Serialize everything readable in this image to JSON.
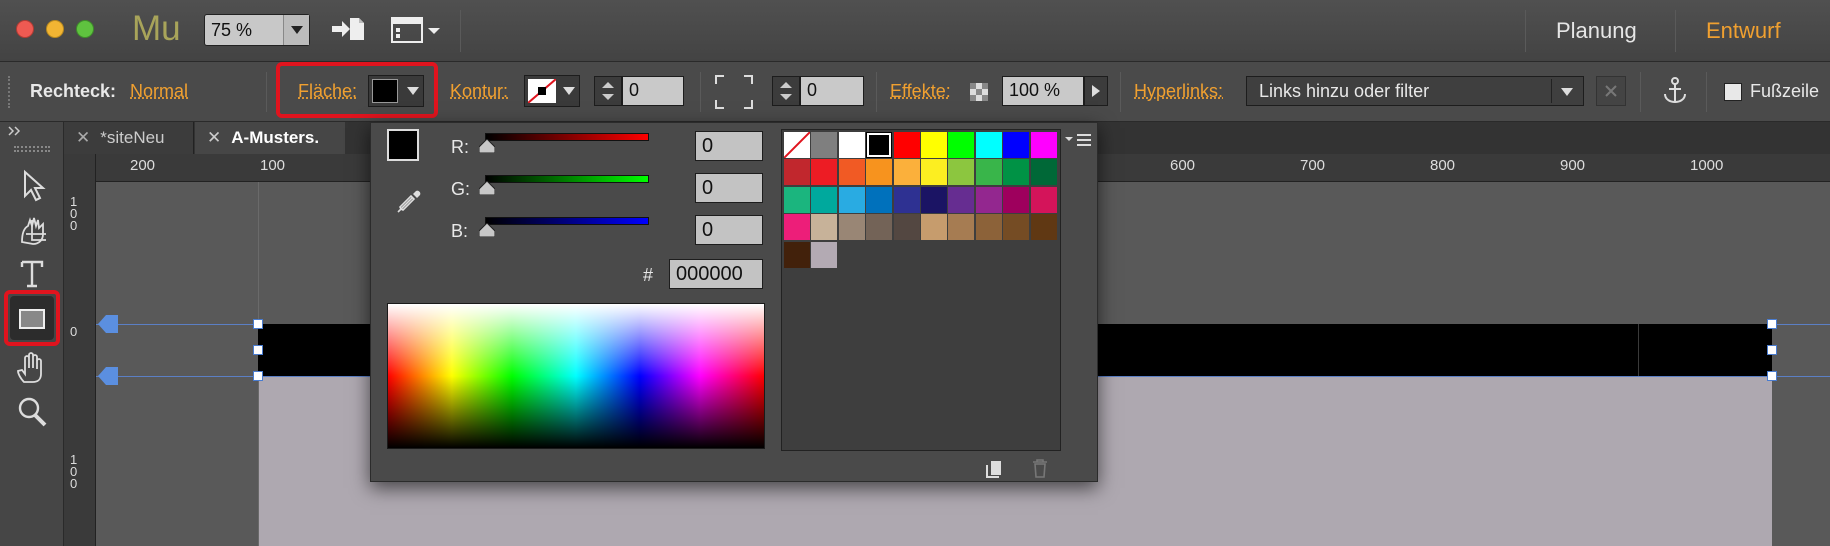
{
  "titlebar": {
    "app_logo": "Mu",
    "zoom": "75 %",
    "modes": {
      "planning": "Planung",
      "design": "Entwurf"
    },
    "traffic_lights": {
      "close": "#ee5a52",
      "minimize": "#f2b533",
      "zoom": "#5fc23f"
    }
  },
  "controlbar": {
    "object_label": "Rechteck:",
    "state": "Normal",
    "fill_label": "Fläche:",
    "stroke_label": "Kontur:",
    "stroke_width": "0",
    "corner_radius": "0",
    "effects_label": "Effekte:",
    "opacity": "100 %",
    "hyperlinks_label": "Hyperlinks:",
    "hyperlinks_placeholder": "Links hinzu oder filter",
    "footer_label": "Fußzeile"
  },
  "tabs": [
    {
      "label": "*siteNeu"
    },
    {
      "label": "A-Musters."
    }
  ],
  "ruler": {
    "top_ticks": [
      "200",
      "100",
      "600",
      "700",
      "800",
      "900",
      "1000"
    ],
    "left_ticks": [
      "100",
      "0",
      "0",
      "100"
    ]
  },
  "color_picker": {
    "r_label": "R:",
    "g_label": "G:",
    "b_label": "B:",
    "r": "0",
    "g": "0",
    "b": "0",
    "hash_label": "#",
    "hex": "000000",
    "current_color": "#000000",
    "swatches": [
      [
        "none",
        "#7f7f7f",
        "#ffffff",
        "#000000",
        "#ff0000",
        "#ffff00",
        "#00ff00",
        "#00ffff",
        "#0000ff",
        "#ff00ff"
      ],
      [
        "#c1272d",
        "#ed1c24",
        "#f15a24",
        "#f7931e",
        "#fbb03b",
        "#fcee21",
        "#8cc63f",
        "#39b54a",
        "#009245",
        "#006837"
      ],
      [
        "#1bb57e",
        "#00a99d",
        "#29abe2",
        "#0071bc",
        "#2e3192",
        "#1b1464",
        "#662d91",
        "#93278f",
        "#9e005d",
        "#d4145a"
      ],
      [
        "#ed1e79",
        "#c7b299",
        "#998675",
        "#736357",
        "#534741",
        "#c69c6d",
        "#a67c52",
        "#8c6239",
        "#754c24",
        "#603813"
      ],
      [
        "#42210b",
        "#b3aab3"
      ]
    ]
  }
}
